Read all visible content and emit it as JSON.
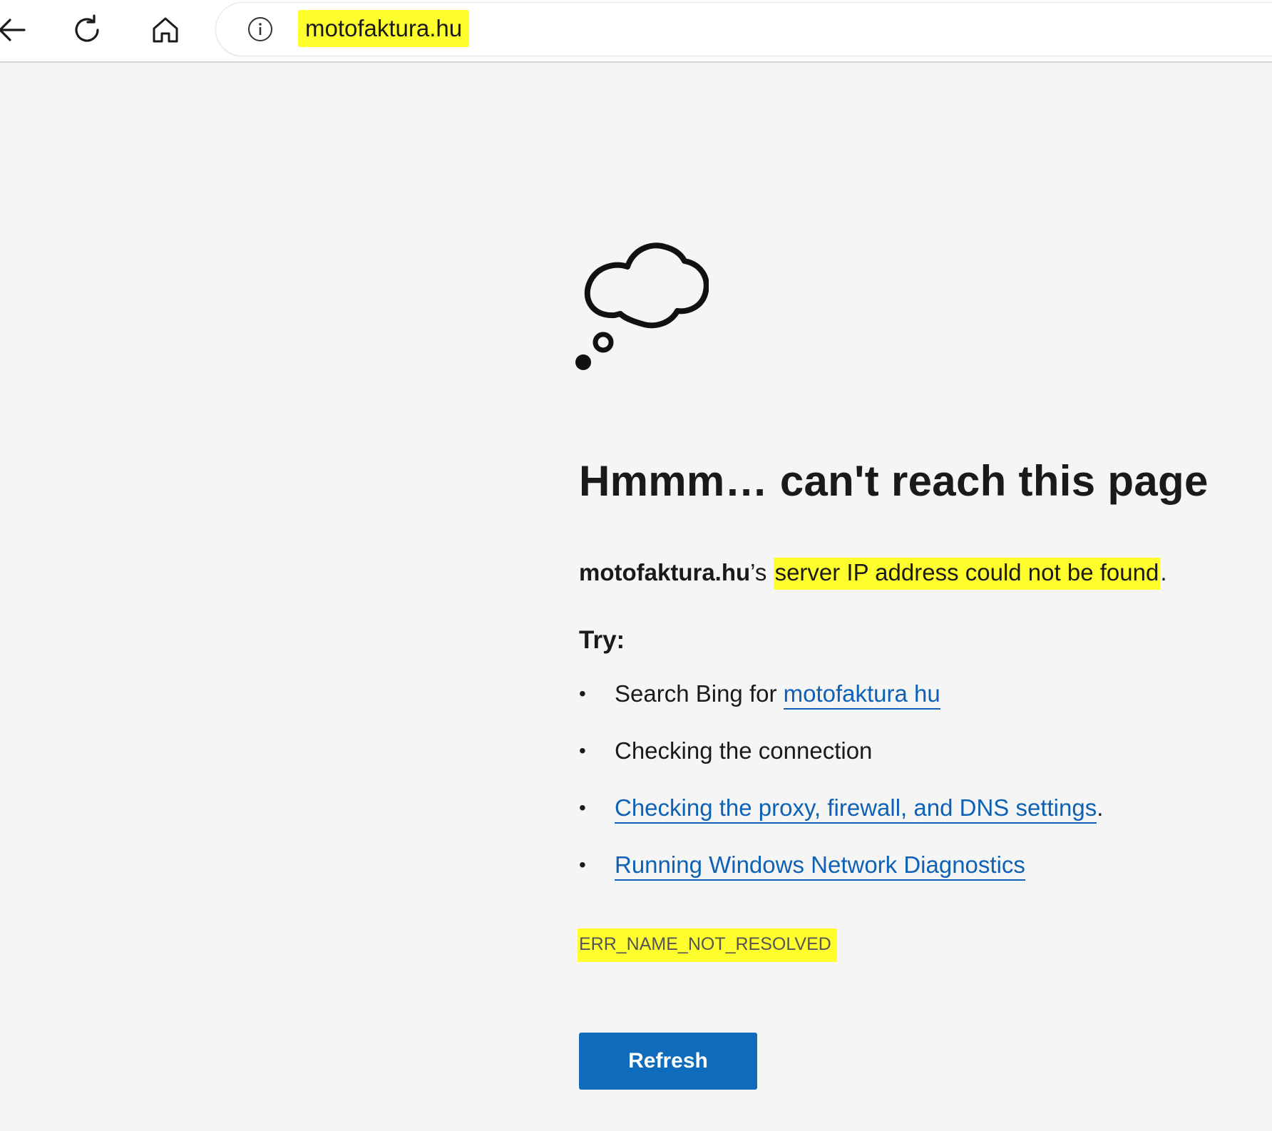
{
  "browser": {
    "address_bar": {
      "url": "motofaktura.hu"
    },
    "icons": {
      "back": "back-arrow-icon",
      "reload": "reload-icon",
      "home": "home-icon",
      "info": "info-icon"
    }
  },
  "error_page": {
    "illustration": "thought-cloud-icon",
    "title": "Hmmm… can't reach this page",
    "message": {
      "host": "motofaktura.hu",
      "possessive": "’s ",
      "highlighted": "server IP address could not be found",
      "trailing": "."
    },
    "try_heading": "Try:",
    "suggestions": [
      {
        "prefix": "Search Bing for ",
        "link": "motofaktura hu",
        "suffix": ""
      },
      {
        "prefix": "Checking the connection",
        "link": "",
        "suffix": ""
      },
      {
        "prefix": "",
        "link": "Checking the proxy, firewall, and DNS settings",
        "suffix": "."
      },
      {
        "prefix": "",
        "link": "Running Windows Network Diagnostics",
        "suffix": ""
      }
    ],
    "bullet": "•",
    "error_code": "ERR_NAME_NOT_RESOLVED",
    "refresh_label": "Refresh"
  },
  "colors": {
    "highlight": "#ffff2e",
    "link": "#0e61b4",
    "button": "#0f6cbd",
    "page_bg": "#f5f5f5"
  }
}
